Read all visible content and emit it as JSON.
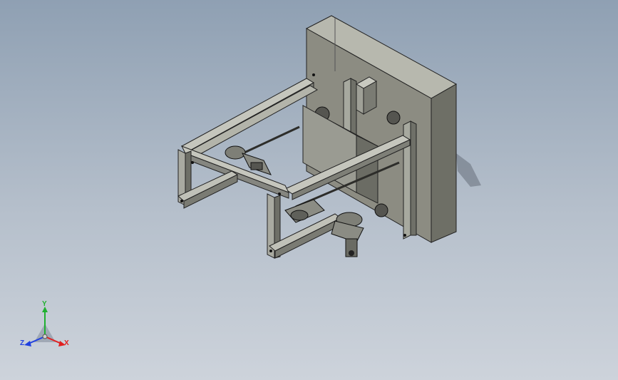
{
  "viewport": {
    "background_top": "#8fa0b3",
    "background_bottom": "#cdd3db"
  },
  "triad": {
    "x_label": "X",
    "y_label": "Y",
    "z_label": "Z",
    "x_color": "#e02020",
    "y_color": "#20b030",
    "z_color": "#2040e0"
  },
  "model": {
    "plate_color": "#8c8c82",
    "frame_color": "#a3a59c",
    "dark_color": "#3a3a36"
  }
}
